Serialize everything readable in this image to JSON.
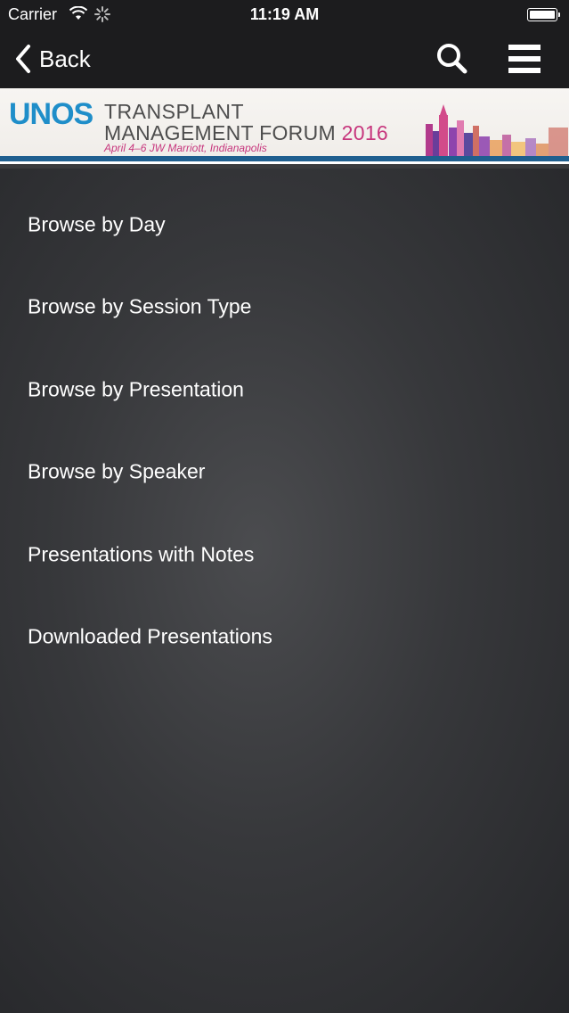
{
  "status_bar": {
    "carrier": "Carrier",
    "time": "11:19 AM"
  },
  "nav": {
    "back_label": "Back",
    "icons": [
      "chevron-left-icon",
      "search-icon",
      "hamburger-menu-icon"
    ]
  },
  "banner": {
    "logo": "UNOS",
    "title_line1": "TRANSPLANT",
    "title_line2": "MANAGEMENT FORUM",
    "year": "2016",
    "details": "April 4–6   JW Marriott, Indianapolis"
  },
  "menu": {
    "items": [
      {
        "label": "Browse by Day"
      },
      {
        "label": "Browse by Session Type"
      },
      {
        "label": "Browse by Presentation"
      },
      {
        "label": "Browse by Speaker"
      },
      {
        "label": "Presentations with Notes"
      },
      {
        "label": "Downloaded Presentations"
      }
    ]
  },
  "colors": {
    "bar_background": "#1c1c1e",
    "content_background": "#37383b",
    "accent_blue": "#1f8ec9",
    "accent_magenta": "#c7367d"
  }
}
